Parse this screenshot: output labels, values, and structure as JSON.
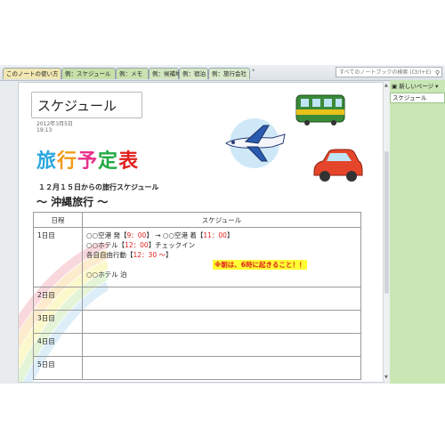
{
  "tabs": [
    {
      "label": "このノートの使い方"
    },
    {
      "label": "例：スケジュール"
    },
    {
      "label": "例：メモ"
    },
    {
      "label": "例：候補地"
    },
    {
      "label": "例：宿泊"
    },
    {
      "label": "例：旅行会社"
    }
  ],
  "tab_add_label": "*",
  "search": {
    "placeholder": "すべてのノートブックの検索 (Ctrl+E)"
  },
  "page": {
    "title": "スケジュール",
    "date": "2012年3月5日",
    "time": "19:13",
    "travel_title": [
      "旅",
      "行",
      "予",
      "定",
      "表"
    ],
    "travel_title_colors": [
      "#2aa8e0",
      "#f09a1a",
      "#e8308a",
      "#22aa44",
      "#e0201c"
    ],
    "subtitle": "１２月１５日からの旅行スケジュール",
    "okinawa": "〜 沖縄旅行 〜"
  },
  "table": {
    "headers": [
      "日程",
      "スケジュール"
    ],
    "rows": [
      {
        "day": "1日目"
      },
      {
        "day": "2日目"
      },
      {
        "day": "3日目"
      },
      {
        "day": "4日目"
      },
      {
        "day": "5日目"
      }
    ],
    "day1": {
      "line1_a": "○○空港 発【",
      "line1_b": "9：00",
      "line1_c": "】 → ○○空港 着【",
      "line1_d": "11：00",
      "line1_e": "】",
      "line2_a": "○○ホテル【",
      "line2_b": "12：00",
      "line2_c": "】チェックイン",
      "line3_a": "各自自由行動【",
      "line3_b": "12：30 ～",
      "line3_c": "】",
      "warning": "※朝は、6時に起きること！！",
      "line4": "○○ホテル 泊"
    }
  },
  "panel": {
    "new_page_label": "新しいページ ▾",
    "items": [
      "スケジュール"
    ]
  },
  "colors": {
    "accent_green": "#c9e6b5",
    "red": "#e0201c",
    "highlight": "#ffff33"
  },
  "icons": [
    "train-icon",
    "airplane-icon",
    "car-icon",
    "search-icon",
    "new-page-icon"
  ]
}
